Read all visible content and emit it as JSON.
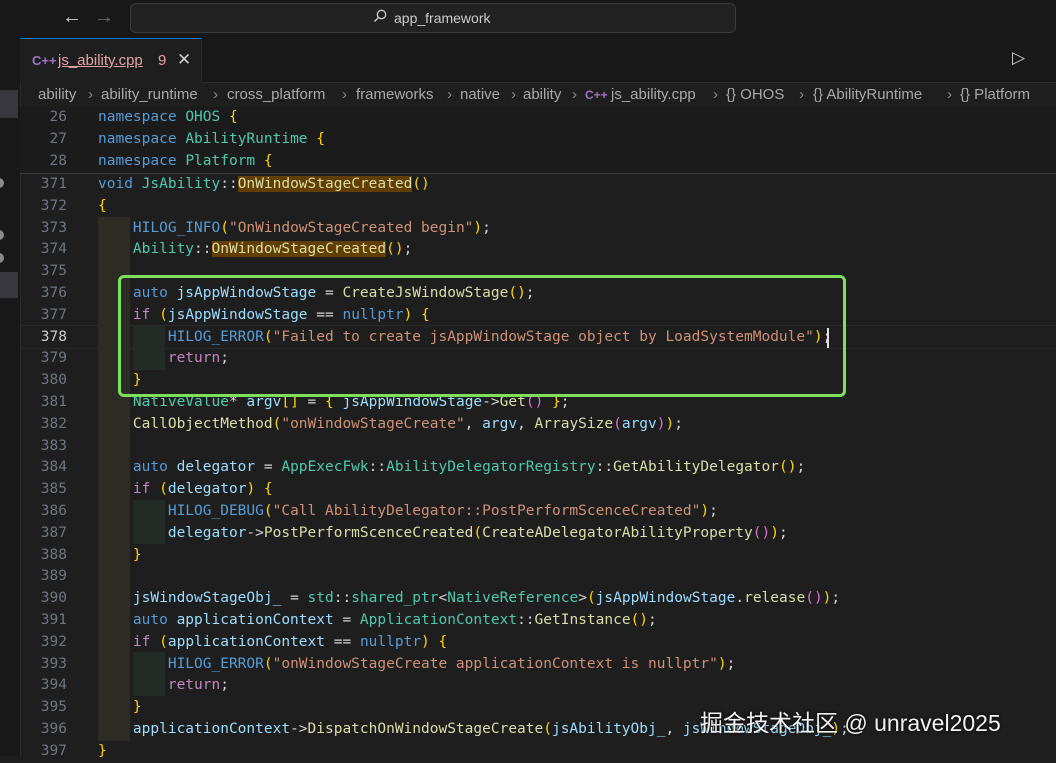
{
  "titlebar": {
    "back_icon": "←",
    "forward_icon": "→",
    "search_text": "app_framework"
  },
  "tab": {
    "icon": "C++",
    "name": "js_ability.cpp",
    "problem_count": "9",
    "close_icon": "✕"
  },
  "toolbar": {
    "run_icon": "▷",
    "more_icon": "⋯"
  },
  "breadcrumb": {
    "items": [
      "ability",
      "ability_runtime",
      "cross_platform",
      "frameworks",
      "native",
      "ability",
      "js_ability.cpp",
      "{} OHOS",
      "{} AbilityRuntime",
      "{} Platform"
    ],
    "separator": "›"
  },
  "editor": {
    "active_line": "378",
    "sticky_lines": [
      {
        "num": "26",
        "text": "namespace OHOS {"
      },
      {
        "num": "27",
        "text": "namespace AbilityRuntime {"
      },
      {
        "num": "28",
        "text": "namespace Platform {"
      }
    ],
    "lines": [
      {
        "num": "371",
        "text": "void JsAbility::OnWindowStageCreated()"
      },
      {
        "num": "372",
        "text": "{"
      },
      {
        "num": "373",
        "text": "    HILOG_INFO(\"OnWindowStageCreated begin\");"
      },
      {
        "num": "374",
        "text": "    Ability::OnWindowStageCreated();"
      },
      {
        "num": "375",
        "text": ""
      },
      {
        "num": "376",
        "text": "    auto jsAppWindowStage = CreateJsWindowStage();"
      },
      {
        "num": "377",
        "text": "    if (jsAppWindowStage == nullptr) {"
      },
      {
        "num": "378",
        "text": "        HILOG_ERROR(\"Failed to create jsAppWindowStage object by LoadSystemModule\");"
      },
      {
        "num": "379",
        "text": "        return;"
      },
      {
        "num": "380",
        "text": "    }"
      },
      {
        "num": "381",
        "text": "    NativeValue* argv[] = { jsAppWindowStage->Get() };"
      },
      {
        "num": "382",
        "text": "    CallObjectMethod(\"onWindowStageCreate\", argv, ArraySize(argv));"
      },
      {
        "num": "383",
        "text": ""
      },
      {
        "num": "384",
        "text": "    auto delegator = AppExecFwk::AbilityDelegatorRegistry::GetAbilityDelegator();"
      },
      {
        "num": "385",
        "text": "    if (delegator) {"
      },
      {
        "num": "386",
        "text": "        HILOG_DEBUG(\"Call AbilityDelegator::PostPerformScenceCreated\");"
      },
      {
        "num": "387",
        "text": "        delegator->PostPerformScenceCreated(CreateADelegatorAbilityProperty());"
      },
      {
        "num": "388",
        "text": "    }"
      },
      {
        "num": "389",
        "text": ""
      },
      {
        "num": "390",
        "text": "    jsWindowStageObj_ = std::shared_ptr<NativeReference>(jsAppWindowStage.release());"
      },
      {
        "num": "391",
        "text": "    auto applicationContext = ApplicationContext::GetInstance();"
      },
      {
        "num": "392",
        "text": "    if (applicationContext == nullptr) {"
      },
      {
        "num": "393",
        "text": "        HILOG_ERROR(\"onWindowStageCreate applicationContext is nullptr\");"
      },
      {
        "num": "394",
        "text": "        return;"
      },
      {
        "num": "395",
        "text": "    }"
      },
      {
        "num": "396",
        "text": "    applicationContext->DispatchOnWindowStageCreate(jsAbilityObj_, jsWindowStageObj_);"
      },
      {
        "num": "397",
        "text": "}"
      }
    ]
  },
  "watermark": "掘金技术社区 @ unravel2025",
  "colors": {
    "highlight_box": "#7ee05a",
    "tab_accent": "#0078d4",
    "keyword": "#569cd6",
    "string": "#ce9178",
    "function": "#dcdcaa",
    "type": "#4ec9b0"
  }
}
